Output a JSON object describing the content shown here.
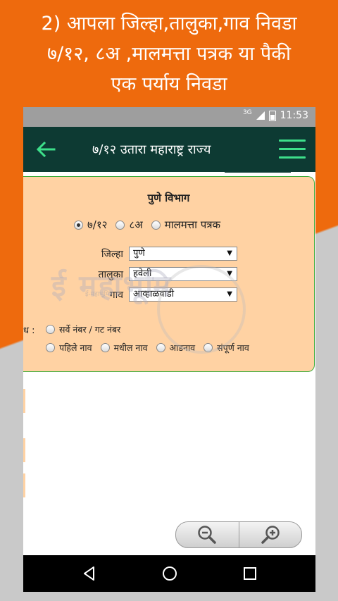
{
  "headline": {
    "line1": "2) आपला जिल्हा,तालुका,गाव निवडा",
    "line2": "७/१२, ८अ ,मालमत्ता पत्रक या पैकी",
    "line3": "एक पर्याय निवडा"
  },
  "status": {
    "network": "3G",
    "time": "11:53"
  },
  "app": {
    "title": "७/१२ उतारा महाराष्ट्र राज्य"
  },
  "form": {
    "division_title": "पुणे विभाग",
    "record_types": [
      {
        "label": "७/१२",
        "checked": true
      },
      {
        "label": "८अ",
        "checked": false
      },
      {
        "label": "मालमत्ता पत्रक",
        "checked": false
      }
    ],
    "district": {
      "label": "जिल्हा",
      "value": "पुणे"
    },
    "taluka": {
      "label": "तालुका",
      "value": "हवेली"
    },
    "village": {
      "label": "गाव",
      "value": "आव्हाळवाडी"
    },
    "search_by": {
      "label": "ध :",
      "options": [
        {
          "label": "सर्वे नंबर / गट नंबर"
        },
        {
          "label": "पहिले नाव"
        },
        {
          "label": "मधील नाव"
        },
        {
          "label": "आडनाव"
        },
        {
          "label": "संपूर्ण नाव"
        }
      ]
    }
  },
  "watermark": {
    "text": "ई महाभूमि",
    "small": "ई-महाभूमि"
  },
  "icons": {
    "back": "arrow-left-icon",
    "menu": "hamburger-icon",
    "zoom_out": "zoom-out-icon",
    "zoom_in": "zoom-in-icon",
    "nav_back": "triangle-back-icon",
    "nav_home": "circle-home-icon",
    "nav_recents": "square-recents-icon"
  },
  "colors": {
    "orange": "#ee6a0d",
    "appbar": "#0d3a33",
    "accent_green": "#3ddf8a",
    "card": "#ffd2a3",
    "card_border": "#3cab3a"
  }
}
